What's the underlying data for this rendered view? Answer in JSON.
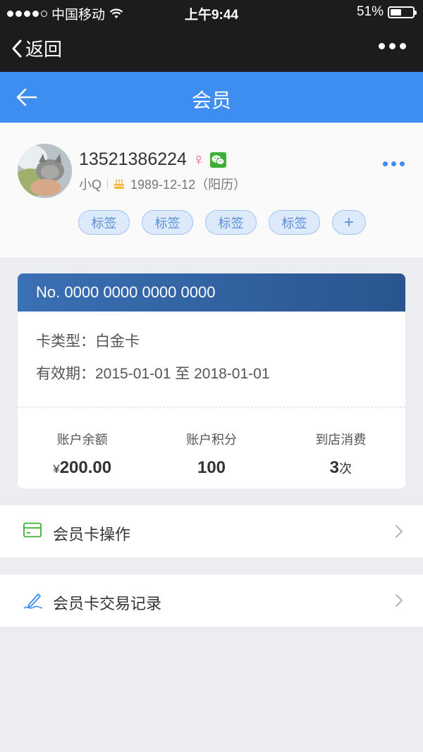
{
  "status_bar": {
    "carrier": "中国移动",
    "time": "上午9:44",
    "battery": "51%",
    "battery_level": 0.51
  },
  "wx_nav": {
    "back_label": "返回"
  },
  "app_header": {
    "title": "会员"
  },
  "profile": {
    "phone": "13521386224",
    "gender_symbol": "♀",
    "nickname": "小Q",
    "birthday": "1989-12-12（阳历）",
    "tags": [
      "标签",
      "标签",
      "标签",
      "标签"
    ],
    "add_tag": "+"
  },
  "card": {
    "number": "No. 0000 0000 0000 0000",
    "type_line": "卡类型：白金卡",
    "validity_line": "有效期：2015-01-01 至 2018-01-01",
    "stats": [
      {
        "label": "账户余额",
        "prefix": "¥",
        "value": "200.00",
        "suffix": ""
      },
      {
        "label": "账户积分",
        "prefix": "",
        "value": "100",
        "suffix": ""
      },
      {
        "label": "到店消费",
        "prefix": "",
        "value": "3",
        "suffix": "次"
      }
    ]
  },
  "menu": {
    "card_ops": "会员卡操作",
    "card_records": "会员卡交易记录"
  },
  "colors": {
    "brand": "#3d8ef0",
    "card_header": "#2f5f9c",
    "wechat": "#3cb034",
    "female": "#ee4f8a"
  }
}
